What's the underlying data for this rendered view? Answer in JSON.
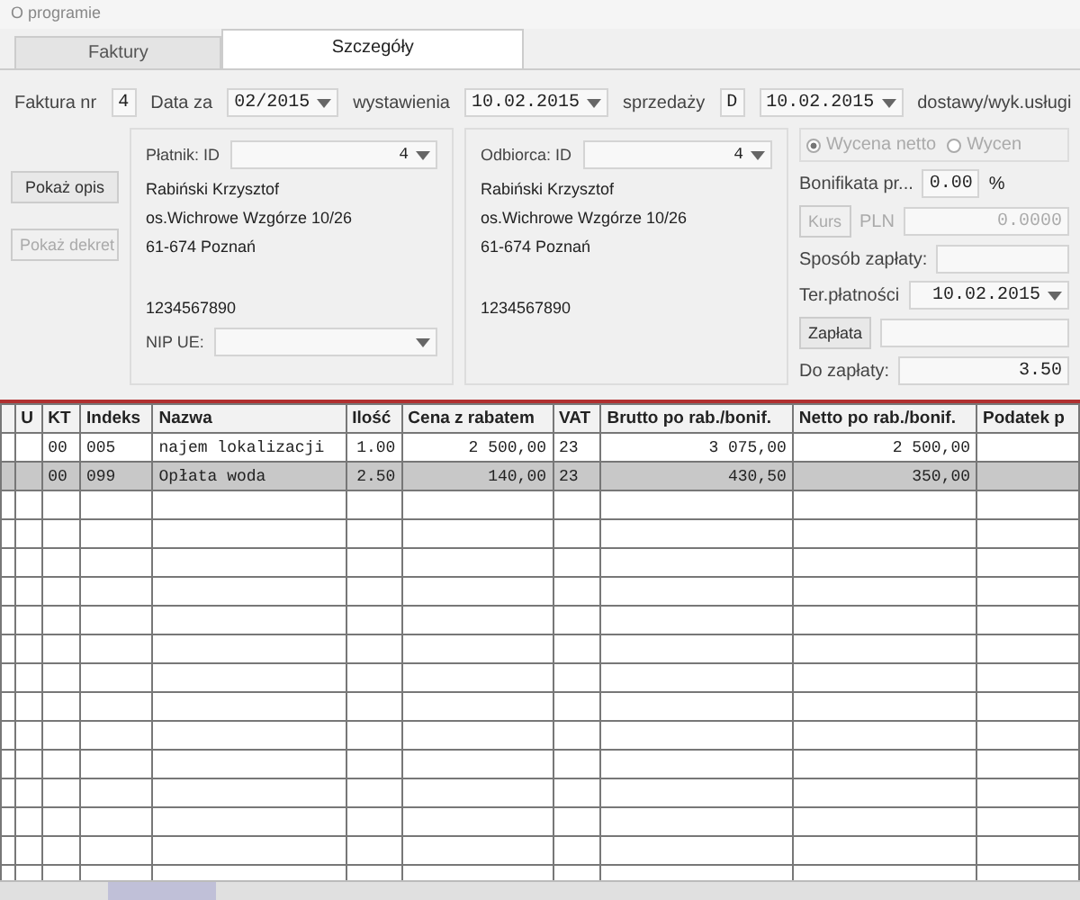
{
  "menu": [
    "O programie"
  ],
  "tabs": [
    {
      "label": "Faktury",
      "selected": false
    },
    {
      "label": "Szczegóły",
      "selected": true
    }
  ],
  "header": {
    "invoice_label": "Faktura nr",
    "invoice_number": "4",
    "period_label": "Data za",
    "period": "02/2015",
    "issue_label": "wystawienia",
    "issue_date": "10.02.2015",
    "sale_label": "sprzedaży",
    "sale_code": "D",
    "sale_date": "10.02.2015",
    "delivery_label": "dostawy/wyk.usługi"
  },
  "side_buttons": [
    {
      "label": "Pokaż opis",
      "disabled": false
    },
    {
      "label": "Pokaż dekret",
      "disabled": true
    }
  ],
  "parties": [
    {
      "label": "Płatnik: ID",
      "id": "4",
      "name": "Rabiński Krzysztof",
      "street": "os.Wichrowe Wzgórze 10/26",
      "city": "61-674 Poznań",
      "nip": "1234567890",
      "nip_ue_label": "NIP UE:"
    },
    {
      "label": "Odbiorca: ID",
      "id": "4",
      "name": "Rabiński Krzysztof",
      "street": "os.Wichrowe Wzgórze 10/26",
      "city": "61-674 Poznań",
      "nip": "1234567890"
    }
  ],
  "pricing": [
    {
      "label": "Wycena netto",
      "selected": true
    },
    {
      "label": "Wycen",
      "selected": false
    }
  ],
  "payment": {
    "discount_label": "Bonifikata pr...",
    "discount": "0.00",
    "percent": "%",
    "rate_button": "Kurs",
    "currency": "PLN",
    "rate": "0.0000",
    "method_label": "Sposób zapłaty:",
    "due_label": "Ter.płatności",
    "due_date": "10.02.2015",
    "pay_button": "Zapłata",
    "total_label": "Do zapłaty:",
    "total": "3.50"
  },
  "table": {
    "columns": [
      "",
      "U",
      "KT",
      "Indeks",
      "Nazwa",
      "Ilość",
      "Cena z rabatem",
      "VAT",
      "Brutto po rab./bonif.",
      "Netto po rab./bonif.",
      "Podatek p"
    ],
    "rows": [
      {
        "selected": false,
        "cells": [
          "",
          "",
          "00",
          "005",
          "najem lokalizacji",
          "1.00",
          "2 500,00",
          "23",
          "3 075,00",
          "2 500,00",
          ""
        ]
      },
      {
        "selected": true,
        "cells": [
          "",
          "",
          "00",
          "099",
          "Opłata woda",
          "2.50",
          "140,00",
          "23",
          "430,50",
          "350,00",
          ""
        ]
      }
    ]
  }
}
